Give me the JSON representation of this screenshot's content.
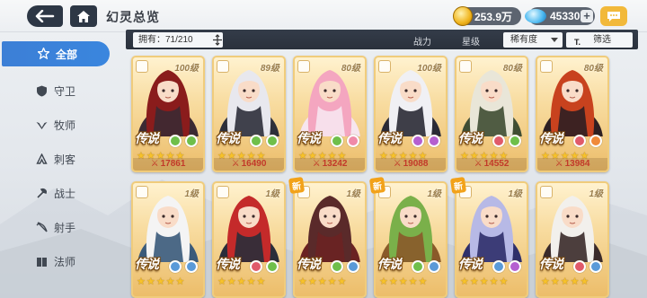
{
  "header": {
    "back_icon": "back-arrow-icon",
    "home_icon": "home-icon",
    "title": "幻灵总览",
    "gold": "253.9万",
    "gems": "45330",
    "gem_add": "+",
    "chat_icon": "chat-icon"
  },
  "sidebar": {
    "items": [
      {
        "label": "全部",
        "icon": "star-outline-icon",
        "active": true
      },
      {
        "label": "守卫",
        "icon": "shield-icon"
      },
      {
        "label": "牧师",
        "icon": "wings-icon"
      },
      {
        "label": "刺客",
        "icon": "dagger-icon"
      },
      {
        "label": "战士",
        "icon": "axe-icon"
      },
      {
        "label": "射手",
        "icon": "bow-icon"
      },
      {
        "label": "法师",
        "icon": "book-icon"
      }
    ]
  },
  "filterbar": {
    "owned_label": "拥有：71/210",
    "power": "战力",
    "stars": "星级",
    "rarity": "稀有度",
    "filter": "筛选"
  },
  "colors": {
    "accent": "#3a86de",
    "card_gold": "#f0cc7c",
    "power_text": "#c23a2a"
  },
  "cards": [
    {
      "level": "100级",
      "rarity": "传说",
      "stars": "★★★★★",
      "power": "17861",
      "el1": "#6fbf4a",
      "el2": "#6fbf4a",
      "hair": "#8a1c1c",
      "outfit": "#3b2a33"
    },
    {
      "level": "89级",
      "rarity": "传说",
      "stars": "★★★★★",
      "power": "16490",
      "el1": "#6fbf4a",
      "el2": "#6fbf4a",
      "hair": "#e8e8ee",
      "outfit": "#2d2f3a"
    },
    {
      "level": "80级",
      "rarity": "传说",
      "stars": "★★★★★",
      "power": "13242",
      "el1": "#6fbf4a",
      "el2": "#f08aa8",
      "hair": "#f4a6c0",
      "outfit": "#f7e6ef"
    },
    {
      "level": "100级",
      "rarity": "传说",
      "stars": "★★★★★",
      "power": "19088",
      "el1": "#b55fd0",
      "el2": "#b55fd0",
      "hair": "#f0f0f4",
      "outfit": "#2a2a35"
    },
    {
      "level": "80级",
      "rarity": "传说",
      "stars": "★★★★★",
      "power": "14552",
      "el1": "#e05a6a",
      "el2": "#6fbf4a",
      "hair": "#e9e6d8",
      "outfit": "#3f4d33"
    },
    {
      "level": "80级",
      "rarity": "传说",
      "stars": "★★★★★",
      "power": "13984",
      "el1": "#e05a6a",
      "el2": "#f08a3a",
      "hair": "#c8421e",
      "outfit": "#2d1f22"
    },
    {
      "level": "1级",
      "rarity": "传说",
      "stars": "★★★★★",
      "power": "",
      "el1": "#5a9ad8",
      "el2": "#5a9ad8",
      "hair": "#f4f4f4",
      "outfit": "#3a5a7a",
      "new": false
    },
    {
      "level": "1级",
      "rarity": "传说",
      "stars": "★★★★★",
      "power": "",
      "el1": "#e05a6a",
      "el2": "#6fbf4a",
      "hair": "#c42a2a",
      "outfit": "#2a2d3a",
      "new": false
    },
    {
      "level": "1级",
      "rarity": "传说",
      "stars": "★★★★★",
      "power": "",
      "el1": "#6fbf4a",
      "el2": "#5a9ad8",
      "hair": "#5a2a2a",
      "outfit": "#6a2222",
      "new": true,
      "new_label": "新"
    },
    {
      "level": "1级",
      "rarity": "传说",
      "stars": "★★★★★",
      "power": "",
      "el1": "#6fbf4a",
      "el2": "#5a9ad8",
      "hair": "#7ab04a",
      "outfit": "#8a5a2a",
      "new": true,
      "new_label": "新"
    },
    {
      "level": "1级",
      "rarity": "传说",
      "stars": "★★★★★",
      "power": "",
      "el1": "#5a9ad8",
      "el2": "#b55fd0",
      "hair": "#b7b9e6",
      "outfit": "#2f2f6a",
      "new": true,
      "new_label": "新"
    },
    {
      "level": "1级",
      "rarity": "传说",
      "stars": "★★★★★",
      "power": "",
      "el1": "#e05a6a",
      "el2": "#5a9ad8",
      "hair": "#f2f0ec",
      "outfit": "#3a2a2a",
      "new": false
    }
  ]
}
